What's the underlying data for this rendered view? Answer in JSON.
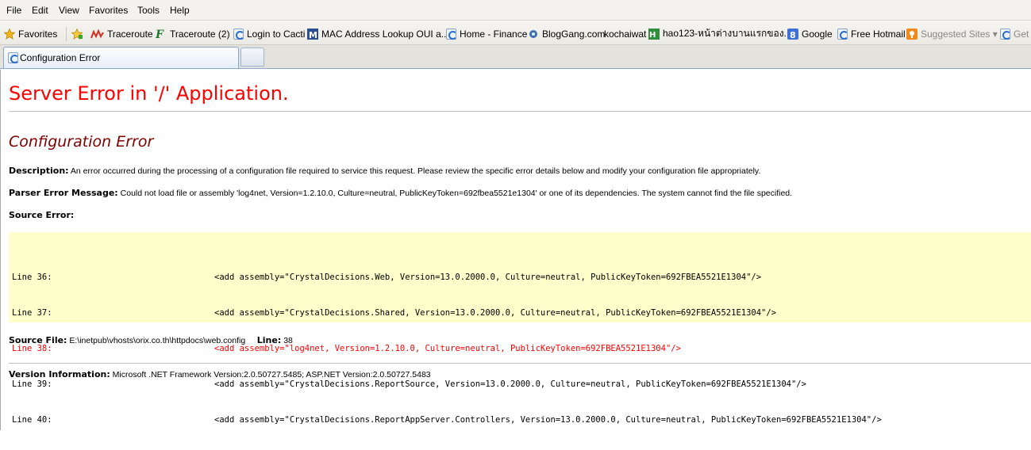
{
  "menu": [
    "File",
    "Edit",
    "View",
    "Favorites",
    "Tools",
    "Help"
  ],
  "favorites_bar": {
    "favorites_label": "Favorites",
    "items": [
      "Traceroute",
      "Traceroute (2)",
      "Login to Cacti",
      "MAC Address Lookup OUI a...",
      "Home - Finance",
      "BlogGang.com",
      "kochaiwat",
      "hao123-หน้าต่างบานแรกของ...",
      "Google",
      "Free Hotmail",
      "Suggested Sites ▾",
      "Get"
    ]
  },
  "tab": {
    "title": "Configuration Error"
  },
  "page": {
    "heading": "Server Error in '/' Application.",
    "subheading": "Configuration Error",
    "description_label": "Description:",
    "description_text": "An error occurred during the processing of a configuration file required to service this request. Please review the specific error details below and modify your configuration file appropriately.",
    "parser_label": "Parser Error Message:",
    "parser_text": "Could not load file or assembly 'log4net, Version=1.2.10.0, Culture=neutral, PublicKeyToken=692fbea5521e1304' or one of its dependencies. The system cannot find the file specified.",
    "source_error_label": "Source Error:",
    "source_lines": [
      {
        "line": "Line 36:",
        "code": "<add assembly=\"CrystalDecisions.Web, Version=13.0.2000.0, Culture=neutral, PublicKeyToken=692FBEA5521E1304\"/>"
      },
      {
        "line": "Line 37:",
        "code": "<add assembly=\"CrystalDecisions.Shared, Version=13.0.2000.0, Culture=neutral, PublicKeyToken=692FBEA5521E1304\"/>"
      },
      {
        "line": "Line 38:",
        "code": "<add assembly=\"log4net, Version=1.2.10.0, Culture=neutral, PublicKeyToken=692FBEA5521E1304\"/>",
        "error": true
      },
      {
        "line": "Line 39:",
        "code": "<add assembly=\"CrystalDecisions.ReportSource, Version=13.0.2000.0, Culture=neutral, PublicKeyToken=692FBEA5521E1304\"/>"
      },
      {
        "line": "Line 40:",
        "code": "<add assembly=\"CrystalDecisions.ReportAppServer.Controllers, Version=13.0.2000.0, Culture=neutral, PublicKeyToken=692FBEA5521E1304\"/>"
      }
    ],
    "source_file_label": "Source File:",
    "source_file_value": "E:\\inetpub\\vhosts\\orix.co.th\\httpdocs\\web.config",
    "line_label": "Line:",
    "line_value": "38",
    "version_label": "Version Information:",
    "version_text": "Microsoft .NET Framework Version:2.0.50727.5485; ASP.NET Version:2.0.50727.5483"
  },
  "colors": {
    "heading": "#ff0000",
    "subheading": "#800000",
    "source_background": "#ffffcc",
    "error_line": "#ff0000"
  }
}
